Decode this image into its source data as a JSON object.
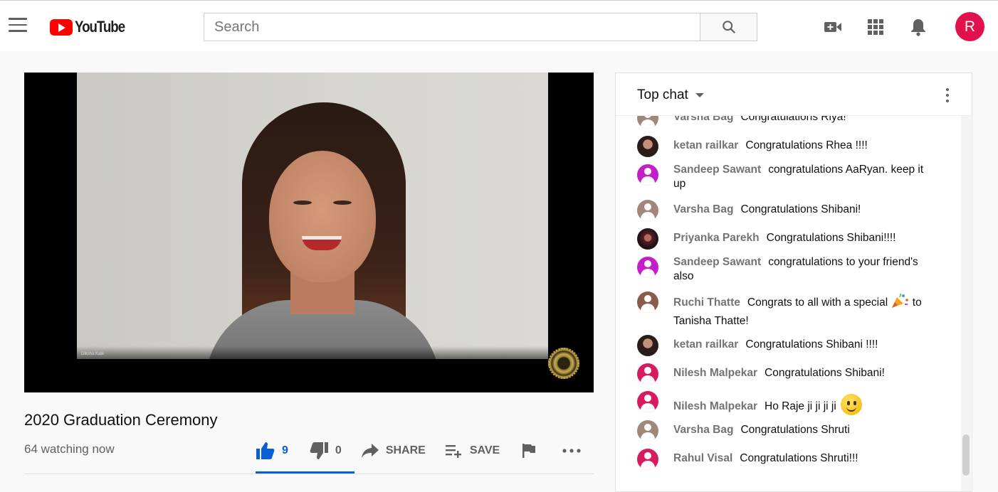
{
  "header": {
    "logo_text": "YouTube",
    "search_placeholder": "Search",
    "avatar_initial": "R",
    "icons": [
      "menu-icon",
      "search-icon",
      "create-video-icon",
      "apps-icon",
      "notifications-icon"
    ]
  },
  "player": {
    "participant_label": "Diksha Kale"
  },
  "video": {
    "title": "2020 Graduation Ceremony",
    "watching": "64 watching now",
    "likes": "9",
    "dislikes": "0",
    "share_label": "SHARE",
    "save_label": "SAVE"
  },
  "chat": {
    "mode": "Top chat",
    "messages": [
      {
        "author": "Varsha Bag",
        "text": "Congratulations Riya!",
        "avatar": "default"
      },
      {
        "author": "ketan railkar",
        "text": "Congratulations Rhea !!!!",
        "avatar": "photo1"
      },
      {
        "author": "Sandeep Sawant",
        "text": "congratulations AaRyan. keep it up",
        "avatar": "magenta"
      },
      {
        "author": "Varsha Bag",
        "text": "Congratulations Shibani!",
        "avatar": "default"
      },
      {
        "author": "Priyanka Parekh",
        "text": "Congratulations Shibani!!!!",
        "avatar": "photo2"
      },
      {
        "author": "Sandeep Sawant",
        "text": "congratulations to your friend's also",
        "avatar": "magenta"
      },
      {
        "author": "Ruchi Thatte",
        "text_before": "Congrats to all with a special",
        "text_after": "to Tanisha Thatte!",
        "emoji": "party-popper",
        "avatar": "brown"
      },
      {
        "author": "ketan railkar",
        "text": "Congratulations Shibani !!!!",
        "avatar": "photo1"
      },
      {
        "author": "Nilesh Malpekar",
        "text": "Congratulations Shibani!",
        "avatar": "pink"
      },
      {
        "author": "Nilesh Malpekar",
        "text": "Ho Raje ji ji ji ji",
        "emoji": "slightly-smiling-face",
        "avatar": "pink"
      },
      {
        "author": "Varsha Bag",
        "text": "Congratulations Shruti",
        "avatar": "default"
      },
      {
        "author": "Rahul Visal",
        "text": "Congratulations Shruti!!!",
        "avatar": "pink"
      }
    ]
  },
  "colors": {
    "youtube_red": "#ff0000",
    "like_blue": "#065fd4",
    "avatar_red": "#e0114c",
    "chat_author_gray": "#737373"
  }
}
